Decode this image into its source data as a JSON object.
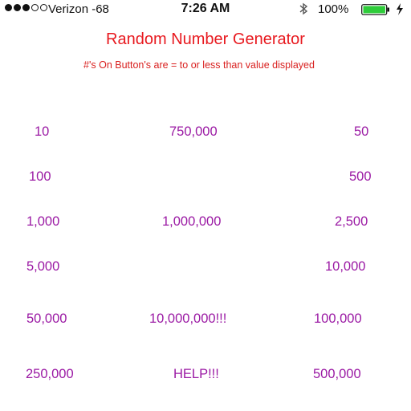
{
  "status_bar": {
    "carrier": "Verizon  -68",
    "time": "7:26 AM",
    "battery": "100%"
  },
  "title": "Random Number Generator",
  "subtitle": "#'s On Button's are = to or less than value displayed",
  "buttons": {
    "b10": "10",
    "b750000": "750,000",
    "b50": "50",
    "b100": "100",
    "b500": "500",
    "b1000": "1,000",
    "b1000000": "1,000,000",
    "b2500": "2,500",
    "b5000": "5,000",
    "b10000": "10,000",
    "b50000": "50,000",
    "b10000000": "10,000,000!!!",
    "b100000": "100,000",
    "b250000": "250,000",
    "help": "HELP!!!",
    "b500000": "500,000"
  },
  "colors": {
    "title": "#e8191f",
    "button_text": "#9b1aa4"
  }
}
